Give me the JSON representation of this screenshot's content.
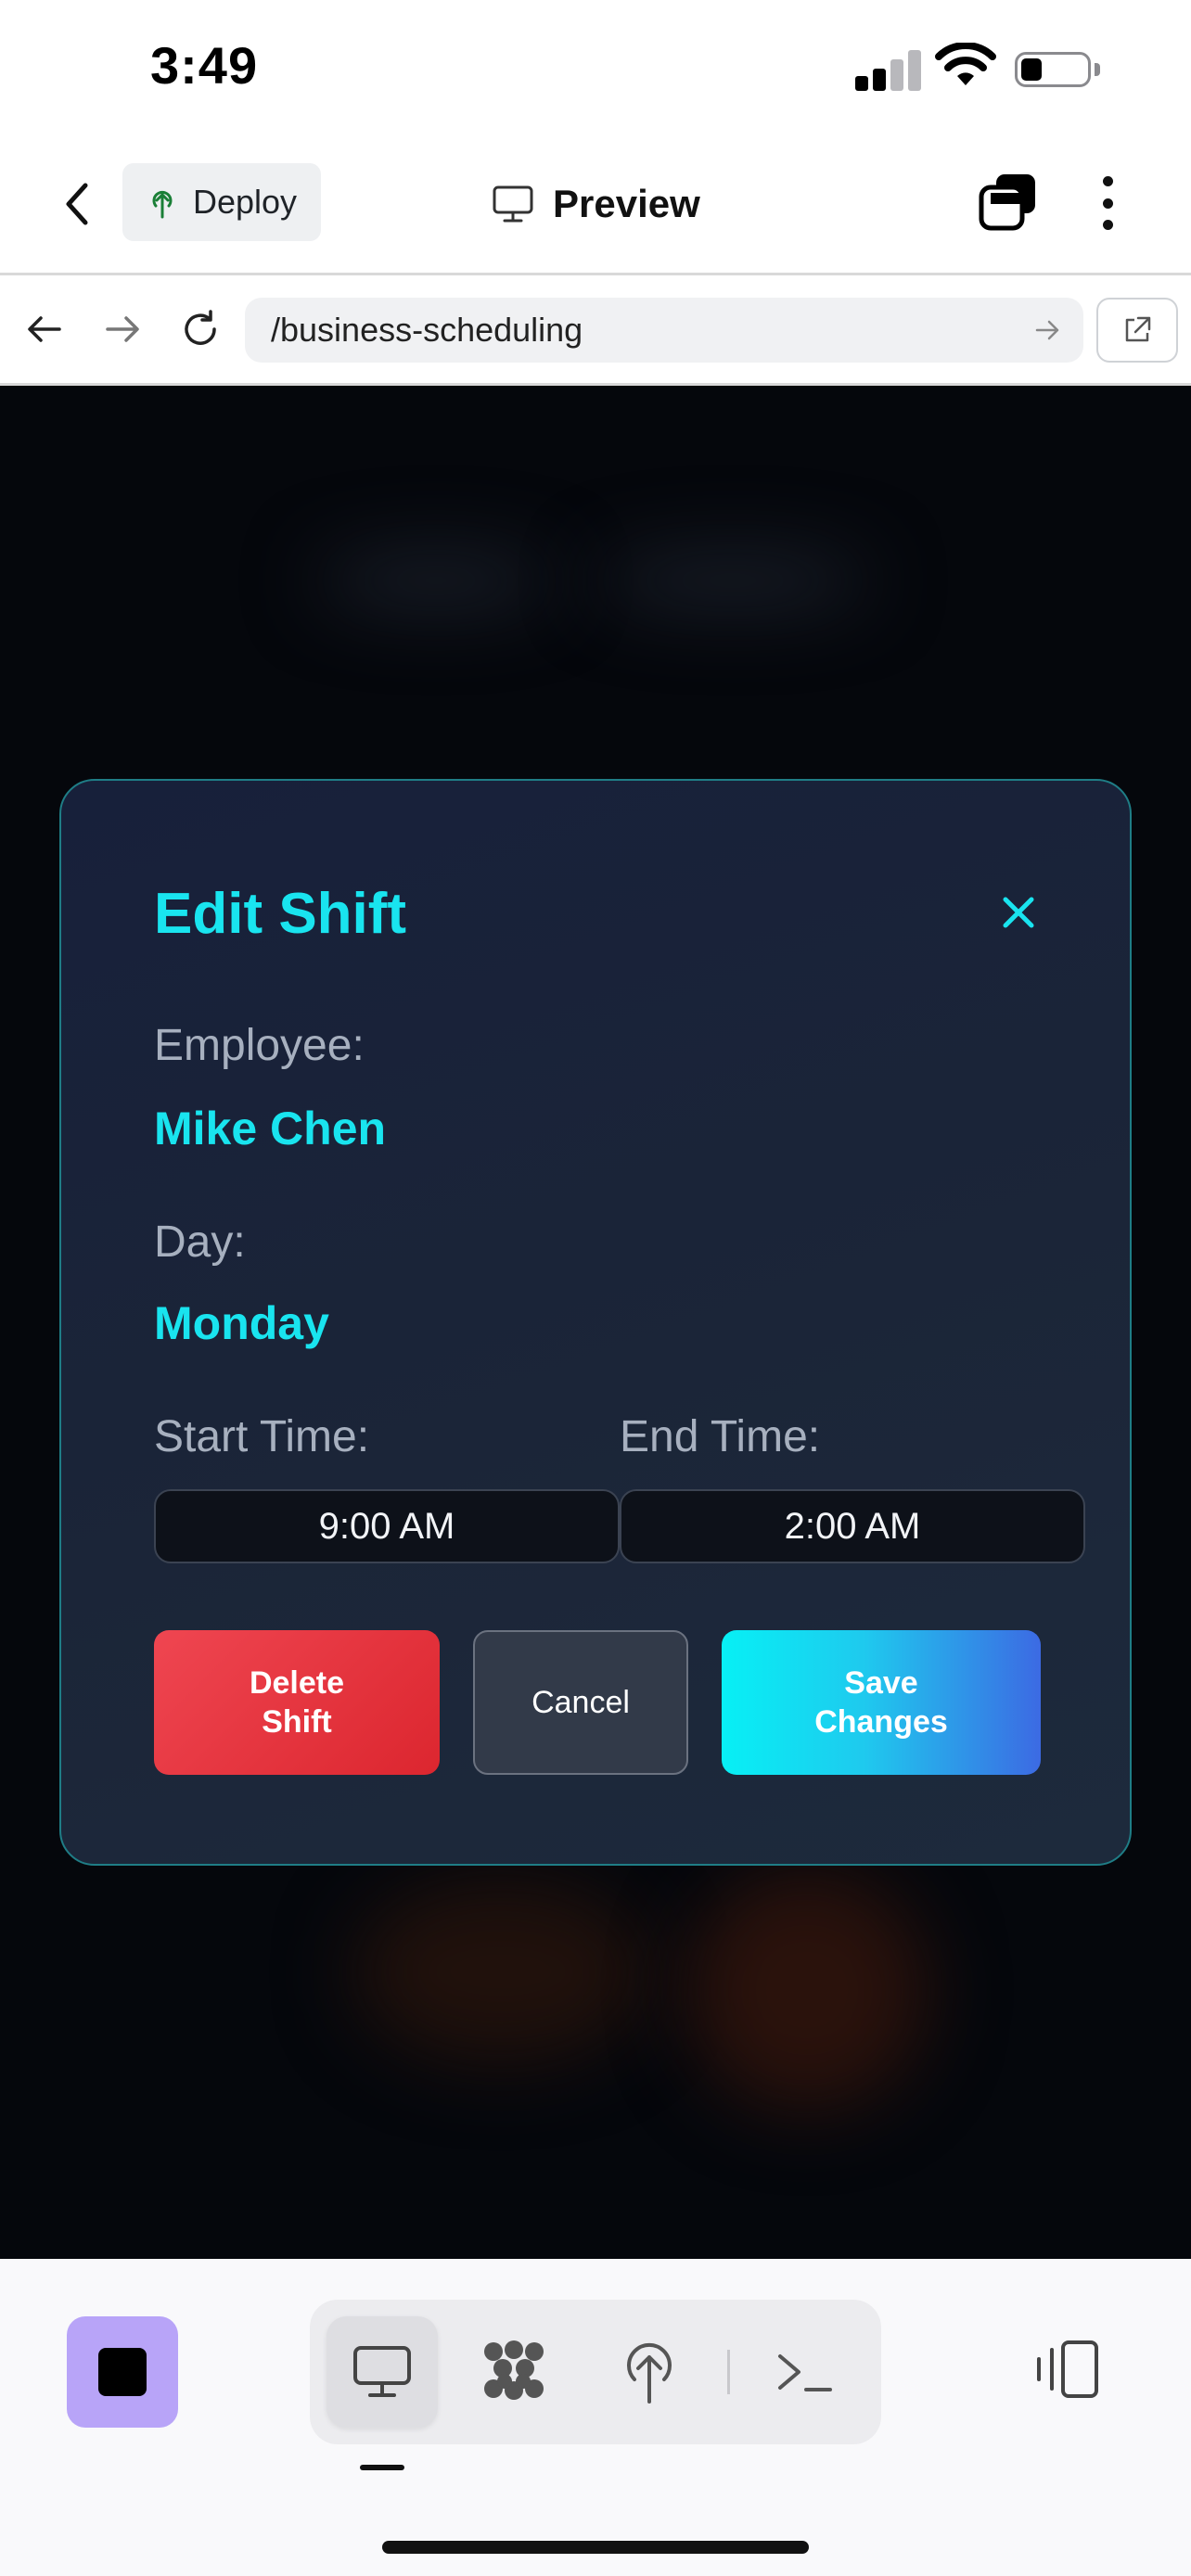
{
  "status_bar": {
    "time": "3:49"
  },
  "header": {
    "back_icon": "chevron-left-icon",
    "deploy_label": "Deploy",
    "deploy_icon": "tree-upload-icon",
    "preview_label": "Preview",
    "preview_icon": "monitor-icon",
    "tabs_icon": "stacked-squares-icon",
    "more_icon": "vertical-ellipsis-icon"
  },
  "browser": {
    "url": "/business-scheduling",
    "back_icon": "arrow-left-icon",
    "forward_icon": "arrow-right-icon",
    "reload_icon": "reload-icon",
    "go_icon": "arrow-right-icon",
    "open_external_icon": "external-link-icon"
  },
  "modal": {
    "title": "Edit Shift",
    "close_icon": "close-icon",
    "employee_label": "Employee:",
    "employee_value": "Mike Chen",
    "day_label": "Day:",
    "day_value": "Monday",
    "start_time_label": "Start Time:",
    "start_time_value": "9:00 AM",
    "end_time_label": "End Time:",
    "end_time_value": "2:00 AM",
    "delete_label": "Delete Shift",
    "cancel_label": "Cancel",
    "save_label": "Save Changes",
    "colors": {
      "accent": "#19e4ef",
      "delete": "#e23b44",
      "save_start": "#07f0f5",
      "save_end": "#3c6ae3",
      "border": "#1f7d86"
    }
  },
  "bottom_toolbar": {
    "stop_icon": "stop-square-icon",
    "items": [
      {
        "icon": "monitor-icon",
        "active": true
      },
      {
        "icon": "dots-cluster-icon",
        "active": false
      },
      {
        "icon": "tree-upload-icon",
        "active": false
      },
      {
        "icon": "terminal-icon",
        "active": false
      }
    ],
    "panel_icon": "device-panel-icon"
  }
}
